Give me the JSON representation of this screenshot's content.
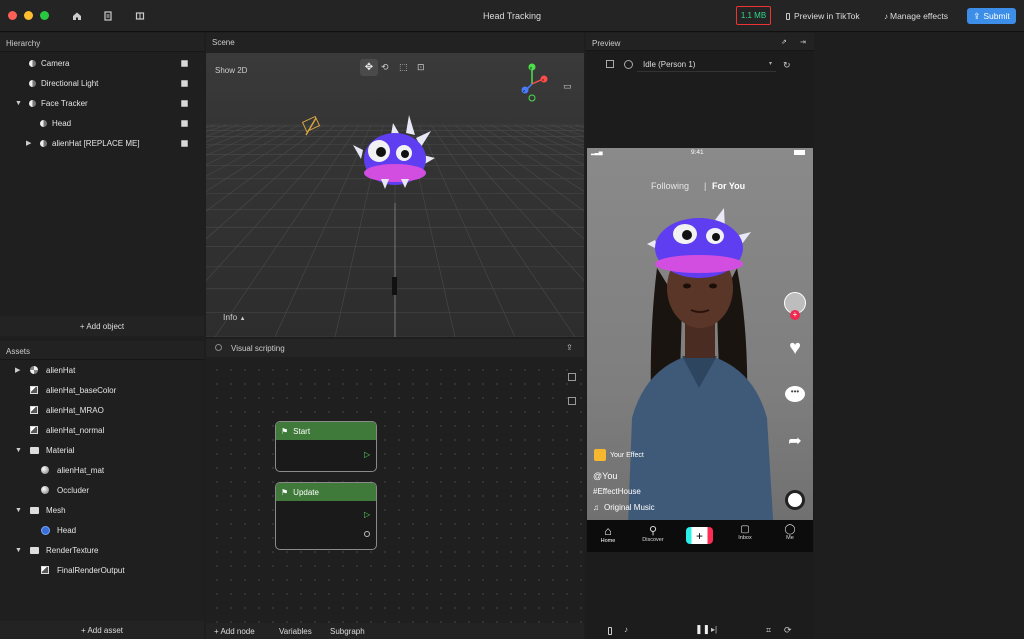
{
  "app": {
    "title": "Head Tracking",
    "file_size": "1.1 MB",
    "preview_label": "Preview in TikTok",
    "manage_label": "Manage effects",
    "submit_label": "Submit"
  },
  "colors": {
    "accent": "#3d8ee8",
    "badge_border": "#ee3333",
    "badge_text": "#30d58a",
    "node_header": "#3f7a3a"
  },
  "hierarchy": {
    "title": "Hierarchy",
    "items": [
      {
        "label": "Camera",
        "checked": true
      },
      {
        "label": "Directional Light",
        "checked": true
      },
      {
        "label": "Face Tracker",
        "checked": true,
        "expanded": true
      },
      {
        "label": "Head",
        "checked": true
      },
      {
        "label": "alienHat [REPLACE ME]",
        "checked": true,
        "expanded": false
      }
    ],
    "add_label": "+ Add object"
  },
  "scene": {
    "title": "Scene",
    "mode_label": "Show 2D",
    "info_label": "Info",
    "gizmo": {
      "x": "x",
      "y": "y",
      "z": "z"
    }
  },
  "assets": {
    "title": "Assets",
    "items": [
      {
        "label": "alienHat",
        "icon": "model-icon"
      },
      {
        "label": "alienHat_baseColor",
        "icon": "texture-icon"
      },
      {
        "label": "alienHat_MRAO",
        "icon": "texture-icon"
      },
      {
        "label": "alienHat_normal",
        "icon": "texture-icon"
      },
      {
        "label": "Material",
        "icon": "folder-icon"
      },
      {
        "label": "alienHat_mat",
        "icon": "material-icon"
      },
      {
        "label": "Occluder",
        "icon": "material-icon"
      },
      {
        "label": "Mesh",
        "icon": "folder-icon"
      },
      {
        "label": "Head",
        "icon": "mesh-icon"
      },
      {
        "label": "RenderTexture",
        "icon": "folder-icon"
      },
      {
        "label": "FinalRenderOutput",
        "icon": "texture-icon"
      }
    ],
    "add_label": "+ Add asset"
  },
  "visual_scripting": {
    "title": "Visual scripting",
    "nodes": [
      {
        "label": "Start"
      },
      {
        "label": "Update"
      }
    ],
    "footer": {
      "add_node": "+ Add node",
      "variables": "Variables",
      "subgraph": "Subgraph"
    }
  },
  "preview": {
    "title": "Preview",
    "mode_select": "Idle (Person 1)",
    "phone": {
      "time": "9:41",
      "tab_following": "Following",
      "tab_for_you": "For You",
      "effect_name": "Your Effect",
      "username": "@You",
      "hashtag": "#EffectHouse",
      "music": "Original Music",
      "nav": [
        "Home",
        "Discover",
        "",
        "Inbox",
        "Me"
      ]
    }
  }
}
